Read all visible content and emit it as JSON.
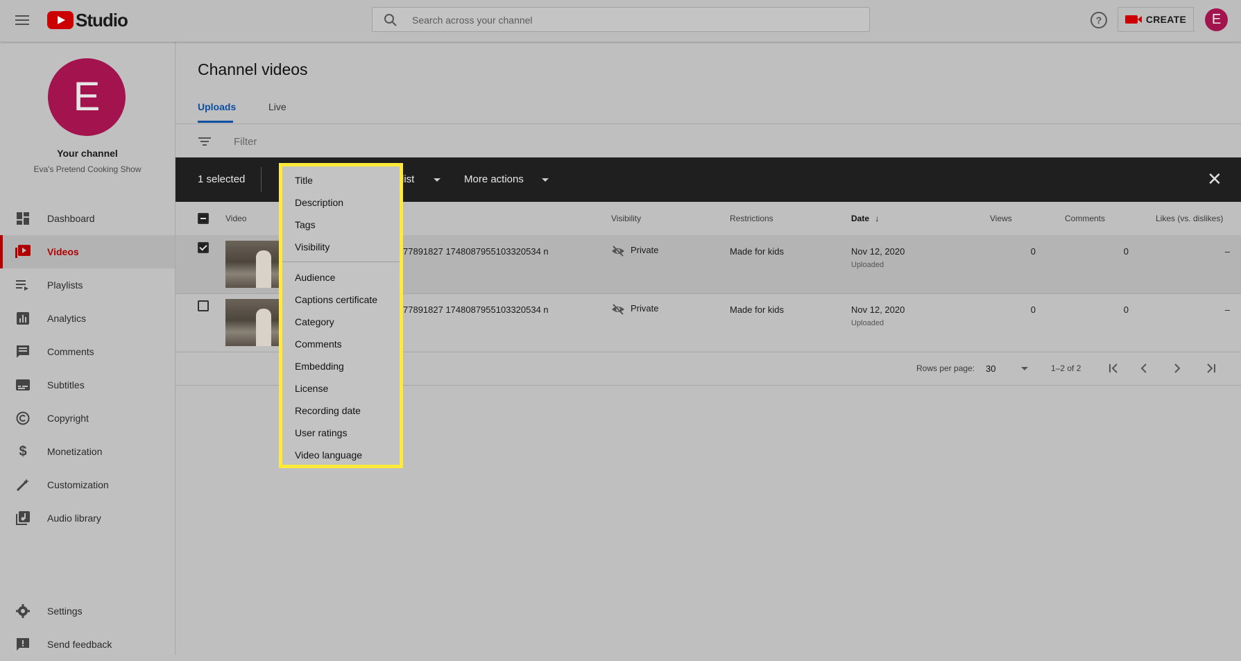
{
  "header": {
    "logo_text": "Studio",
    "search_placeholder": "Search across your channel",
    "help_label": "?",
    "create_label": "CREATE",
    "avatar_letter": "E"
  },
  "sidebar": {
    "avatar_letter": "E",
    "channel_label": "Your channel",
    "channel_name": "Eva's Pretend Cooking Show",
    "items": [
      {
        "label": "Dashboard",
        "icon": "dashboard-icon"
      },
      {
        "label": "Videos",
        "icon": "videos-icon",
        "active": true
      },
      {
        "label": "Playlists",
        "icon": "playlists-icon"
      },
      {
        "label": "Analytics",
        "icon": "analytics-icon"
      },
      {
        "label": "Comments",
        "icon": "comments-icon"
      },
      {
        "label": "Subtitles",
        "icon": "subtitles-icon"
      },
      {
        "label": "Copyright",
        "icon": "copyright-icon"
      },
      {
        "label": "Monetization",
        "icon": "monetization-icon"
      },
      {
        "label": "Customization",
        "icon": "customization-icon"
      },
      {
        "label": "Audio library",
        "icon": "audio-library-icon"
      }
    ],
    "settings_label": "Settings",
    "feedback_label": "Send feedback"
  },
  "main": {
    "title": "Channel videos",
    "tabs": [
      "Uploads",
      "Live"
    ],
    "filter_placeholder": "Filter",
    "action_bar": {
      "selected_text": "1 selected",
      "playlist_partial": "list",
      "more_actions": "More actions",
      "close": "✕"
    },
    "table": {
      "headers": {
        "video": "Video",
        "visibility": "Visibility",
        "restrictions": "Restrictions",
        "date": "Date",
        "date_sort": "↓",
        "views": "Views",
        "comments": "Comments",
        "likes": "Likes (vs. dislikes)"
      },
      "rows": [
        {
          "title": "77891827 1748087955103320534 n",
          "visibility": "Private",
          "restrictions": "Made for kids",
          "date": "Nov 12, 2020",
          "date_sub": "Uploaded",
          "views": "0",
          "comments": "0",
          "likes": "–",
          "selected": true
        },
        {
          "title": "77891827 1748087955103320534 n",
          "visibility": "Private",
          "restrictions": "Made for kids",
          "date": "Nov 12, 2020",
          "date_sub": "Uploaded",
          "views": "0",
          "comments": "0",
          "likes": "–",
          "selected": false
        }
      ]
    },
    "pagination": {
      "rows_per_page_label": "Rows per page:",
      "rows_per_page_value": "30",
      "range": "1–2 of 2"
    }
  },
  "dropdown_menu": {
    "group1": [
      "Title",
      "Description",
      "Tags",
      "Visibility"
    ],
    "group2": [
      "Audience",
      "Captions certificate",
      "Category",
      "Comments",
      "Embedding",
      "License",
      "Recording date",
      "User ratings",
      "Video language"
    ]
  }
}
